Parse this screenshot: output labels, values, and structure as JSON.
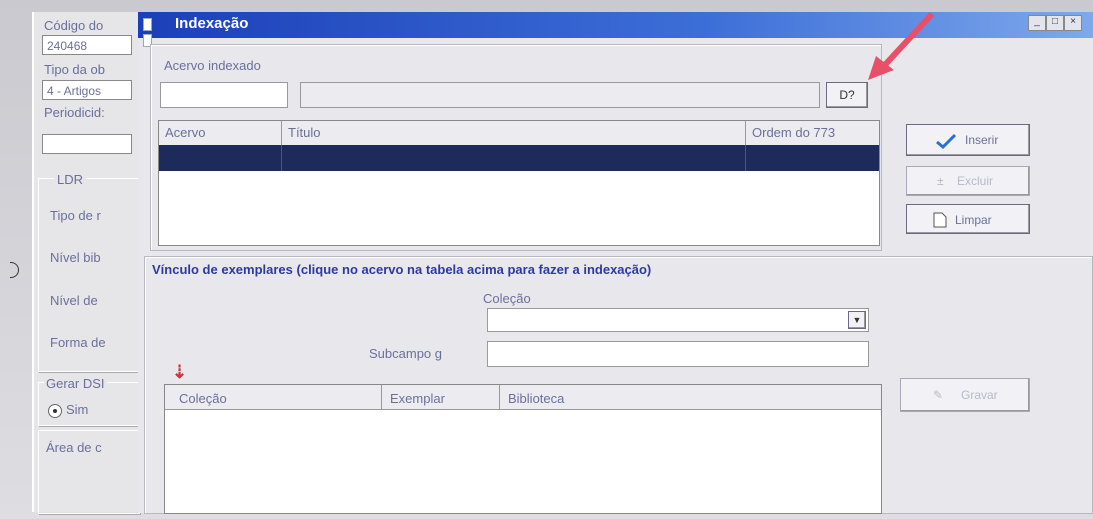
{
  "background_form": {
    "codigo_label": "Código do",
    "codigo_value": "240468",
    "tipo_obra_label": "Tipo da ob",
    "tipo_obra_value": "4 - Artigos",
    "periodicidade_label": "Periodicid:",
    "ldr_group_label": "LDR",
    "tipo_registro_label": "Tipo de r",
    "nivel_bib_label": "Nível bib",
    "nivel_de_label": "Nível de",
    "forma_de_label": "Forma de",
    "gerar_dsi_label": "Gerar DSI",
    "sim_radio_label": "Sim",
    "area_label": "Área de c"
  },
  "dialog": {
    "title": "Indexação",
    "acervo_indexado_label": "Acervo indexado",
    "search_button_label": "D?",
    "grid1": {
      "columns": [
        "Acervo",
        "Título",
        "Ordem do 773"
      ]
    },
    "buttons": {
      "inserir": "Inserir",
      "excluir": "Excluir",
      "limpar": "Limpar",
      "gravar": "Gravar"
    },
    "vinculo_label": "Vínculo de exemplares (clique no acervo na tabela acima para fazer a indexação)",
    "colecao_label": "Coleção",
    "subcampo_label": "Subcampo g",
    "grid2": {
      "columns": [
        "Coleção",
        "Exemplar",
        "Biblioteca"
      ]
    }
  },
  "colors": {
    "titlebar": "#1b3fb8",
    "selected_row": "#1c2a5c",
    "arrow": "#e8506a"
  }
}
